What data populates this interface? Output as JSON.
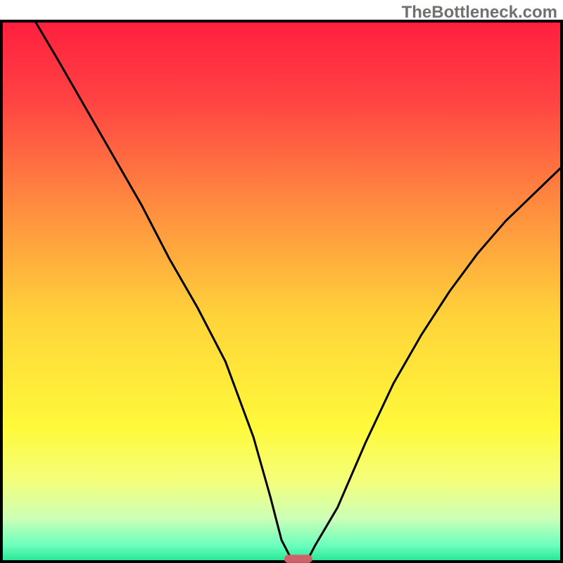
{
  "watermark": "TheBottleneck.com",
  "chart_data": {
    "type": "line",
    "title": "",
    "xlabel": "",
    "ylabel": "",
    "xlim": [
      0,
      100
    ],
    "ylim": [
      0,
      100
    ],
    "grid": false,
    "legend": false,
    "background_gradient": {
      "stops": [
        {
          "offset": 0.0,
          "color": "#ff1f3f"
        },
        {
          "offset": 0.15,
          "color": "#ff4443"
        },
        {
          "offset": 0.35,
          "color": "#ff8f3f"
        },
        {
          "offset": 0.55,
          "color": "#ffd43a"
        },
        {
          "offset": 0.75,
          "color": "#fff93a"
        },
        {
          "offset": 0.85,
          "color": "#f4ff7a"
        },
        {
          "offset": 0.92,
          "color": "#ccffb7"
        },
        {
          "offset": 0.97,
          "color": "#6bffbd"
        },
        {
          "offset": 1.0,
          "color": "#23e592"
        }
      ]
    },
    "series": [
      {
        "name": "bottleneck-curve",
        "x": [
          6,
          10,
          15,
          20,
          25,
          30,
          35,
          40,
          45,
          48,
          50,
          51.5,
          53,
          55,
          56,
          60,
          65,
          70,
          75,
          80,
          85,
          90,
          95,
          100
        ],
        "y": [
          100,
          93,
          84,
          75,
          66,
          56,
          47,
          37,
          23,
          12,
          4,
          1,
          0.5,
          1,
          3,
          10,
          22,
          33,
          42,
          50,
          57,
          63,
          68,
          73
        ]
      }
    ],
    "marker": {
      "name": "optimal-marker",
      "x": 53,
      "y": 0.5,
      "width_pct": 5,
      "height_pct": 1.5,
      "color": "#cf6168"
    },
    "frame": {
      "left": 2,
      "right": 2,
      "top": 4,
      "bottom": 2,
      "color": "#000000"
    }
  }
}
